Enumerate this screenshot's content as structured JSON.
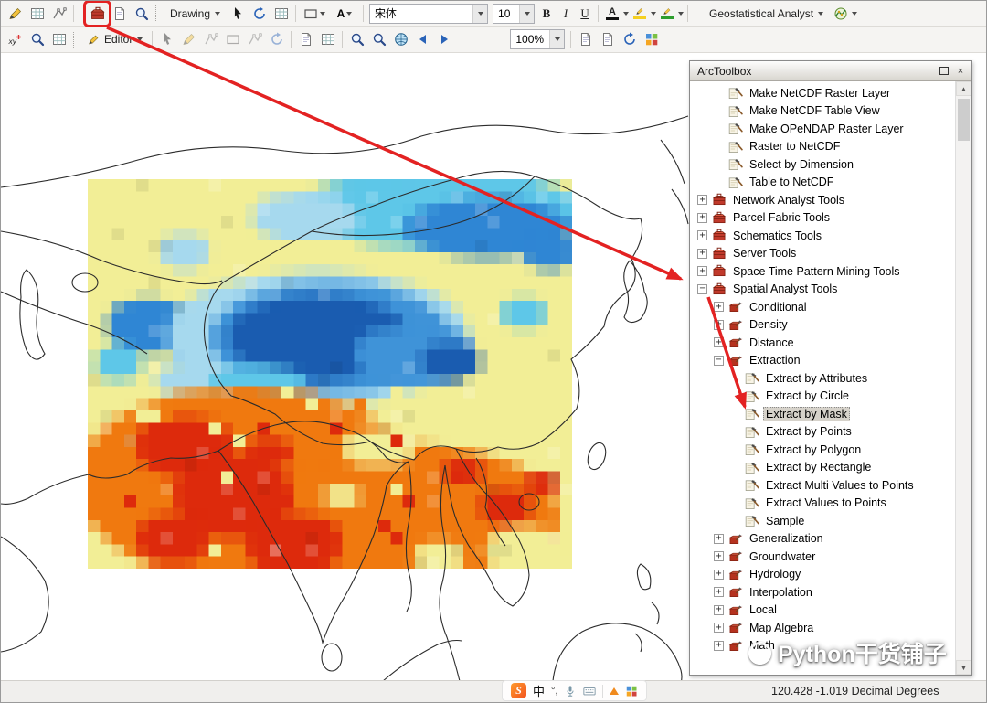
{
  "toolbar1": {
    "drawing_label": "Drawing",
    "font_name": "宋体",
    "font_size": "10",
    "bold": "B",
    "italic": "I",
    "underline": "U",
    "color_letter": "A",
    "geostatistical_label": "Geostatistical Analyst"
  },
  "toolbar2": {
    "editor_label": "Editor",
    "zoom_value": "100%"
  },
  "panel": {
    "title": "ArcToolbox",
    "tree": [
      {
        "label": "Make NetCDF Raster Layer",
        "type": "tool",
        "level": 2
      },
      {
        "label": "Make NetCDF Table View",
        "type": "tool",
        "level": 2
      },
      {
        "label": "Make OPeNDAP Raster Layer",
        "type": "tool",
        "level": 2
      },
      {
        "label": "Raster to NetCDF",
        "type": "tool",
        "level": 2
      },
      {
        "label": "Select by Dimension",
        "type": "tool",
        "level": 2
      },
      {
        "label": "Table to NetCDF",
        "type": "tool",
        "level": 2
      },
      {
        "label": "Network Analyst Tools",
        "type": "toolbox",
        "level": 1,
        "expanded": false
      },
      {
        "label": "Parcel Fabric Tools",
        "type": "toolbox",
        "level": 1,
        "expanded": false
      },
      {
        "label": "Schematics Tools",
        "type": "toolbox",
        "level": 1,
        "expanded": false
      },
      {
        "label": "Server Tools",
        "type": "toolbox",
        "level": 1,
        "expanded": false
      },
      {
        "label": "Space Time Pattern Mining Tools",
        "type": "toolbox",
        "level": 1,
        "expanded": false
      },
      {
        "label": "Spatial Analyst Tools",
        "type": "toolbox",
        "level": 1,
        "expanded": true
      },
      {
        "label": "Conditional",
        "type": "toolset",
        "level": 2,
        "expanded": false
      },
      {
        "label": "Density",
        "type": "toolset",
        "level": 2,
        "expanded": false
      },
      {
        "label": "Distance",
        "type": "toolset",
        "level": 2,
        "expanded": false
      },
      {
        "label": "Extraction",
        "type": "toolset",
        "level": 2,
        "expanded": true
      },
      {
        "label": "Extract by Attributes",
        "type": "tool",
        "level": 3
      },
      {
        "label": "Extract by Circle",
        "type": "tool",
        "level": 3
      },
      {
        "label": "Extract by Mask",
        "type": "tool",
        "level": 3,
        "selected": true
      },
      {
        "label": "Extract by Points",
        "type": "tool",
        "level": 3
      },
      {
        "label": "Extract by Polygon",
        "type": "tool",
        "level": 3
      },
      {
        "label": "Extract by Rectangle",
        "type": "tool",
        "level": 3
      },
      {
        "label": "Extract Multi Values to Points",
        "type": "tool",
        "level": 3
      },
      {
        "label": "Extract Values to Points",
        "type": "tool",
        "level": 3
      },
      {
        "label": "Sample",
        "type": "tool",
        "level": 3
      },
      {
        "label": "Generalization",
        "type": "toolset",
        "level": 2,
        "expanded": false
      },
      {
        "label": "Groundwater",
        "type": "toolset",
        "level": 2,
        "expanded": false
      },
      {
        "label": "Hydrology",
        "type": "toolset",
        "level": 2,
        "expanded": false
      },
      {
        "label": "Interpolation",
        "type": "toolset",
        "level": 2,
        "expanded": false
      },
      {
        "label": "Local",
        "type": "toolset",
        "level": 2,
        "expanded": false
      },
      {
        "label": "Map Algebra",
        "type": "toolset",
        "level": 2,
        "expanded": false
      },
      {
        "label": "Math",
        "type": "toolset",
        "level": 2,
        "expanded": false
      }
    ]
  },
  "statusbar": {
    "coordinates": "120.428 -1.019 Decimal Degrees"
  },
  "ime": {
    "brand": "S",
    "mode": "中",
    "punct": "°,"
  },
  "watermark": {
    "text": "Python干货铺子"
  },
  "map": {
    "raster": {
      "base": "#f2ee96",
      "cyan": "#5ec7e8",
      "paleblue": "#a6d9ee",
      "blue": "#2f86d4",
      "mid": "#3f93d8",
      "dark": "#1a5cb0",
      "orange": "#f0790f",
      "red": "#dd2a0c"
    }
  },
  "colors": {
    "annotation": "#e32222",
    "selection_bg": "#d6d2ca"
  }
}
